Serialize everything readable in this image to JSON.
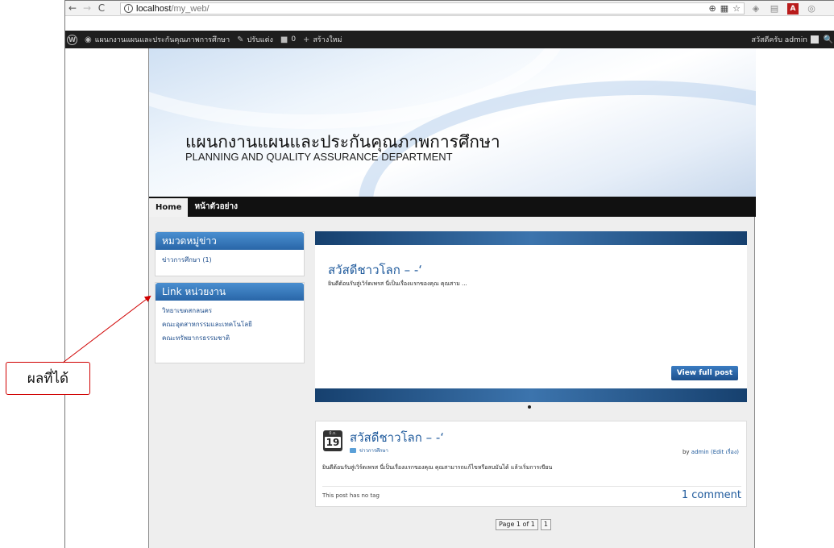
{
  "browser": {
    "back_icon": "←",
    "forward_icon": "→",
    "reload_icon": "C",
    "info_icon": "i",
    "url_host": "localhost",
    "url_path": "/my_web/",
    "zoom_icon": "⊕",
    "translate_icon": "▦",
    "star_icon": "☆"
  },
  "adminbar": {
    "site_name": "แผนกงานแผนและประกันคุณภาพการศึกษา",
    "customize": "ปรับแต่ง",
    "comments_count": "0",
    "new_item": "สร้างใหม่",
    "greeting": "สวัสดีครับ admin",
    "search_icon": "🔍"
  },
  "header": {
    "title": "แผนกงานแผนและประกันคุณภาพการศึกษา",
    "subtitle": "PLANNING AND QUALITY ASSURANCE DEPARTMENT"
  },
  "nav": {
    "items": [
      "Home",
      "หน้าตัวอย่าง"
    ]
  },
  "sidebar": {
    "categories_title": "หมวดหมู่ข่าว",
    "categories": [
      "ข่าวการศึกษา (1)"
    ],
    "links_title": "Link หน่วยงาน",
    "links": [
      "วิทยาเขตสกลนคร",
      "คณะอุตสาหกรรมและเทคโนโลยี",
      "คณะทรัพยากรธรรมชาติ"
    ]
  },
  "slider": {
    "title": "สวัสดีชาวโลก – -‘",
    "excerpt": "ยินดีต้อนรับสู่เวิร์ดเพรส นี่เป็นเรื่องแรกของคุณ คุณสาม ...",
    "button": "View full post"
  },
  "post": {
    "month": "มิ.ย.",
    "day": "19",
    "title": "สวัสดีชาวโลก – -‘",
    "category": "ข่าวการศึกษา",
    "by_prefix": "by",
    "author": "admin",
    "edit_link": "(Edit เรื่อง)",
    "excerpt": "ยินดีต้อนรับสู่เวิร์ดเพรส นี่เป็นเรื่องแรกของคุณ คุณสามารถแก้ไขหรือลบมันได้ แล้วเริ่มการเขียน",
    "tags": "This post has no tag",
    "comments": "1 comment"
  },
  "pagination": {
    "label": "Page 1 of 1",
    "current": "1"
  },
  "annotation": {
    "label": "ผลที่ได้",
    "color": "#d00000"
  }
}
